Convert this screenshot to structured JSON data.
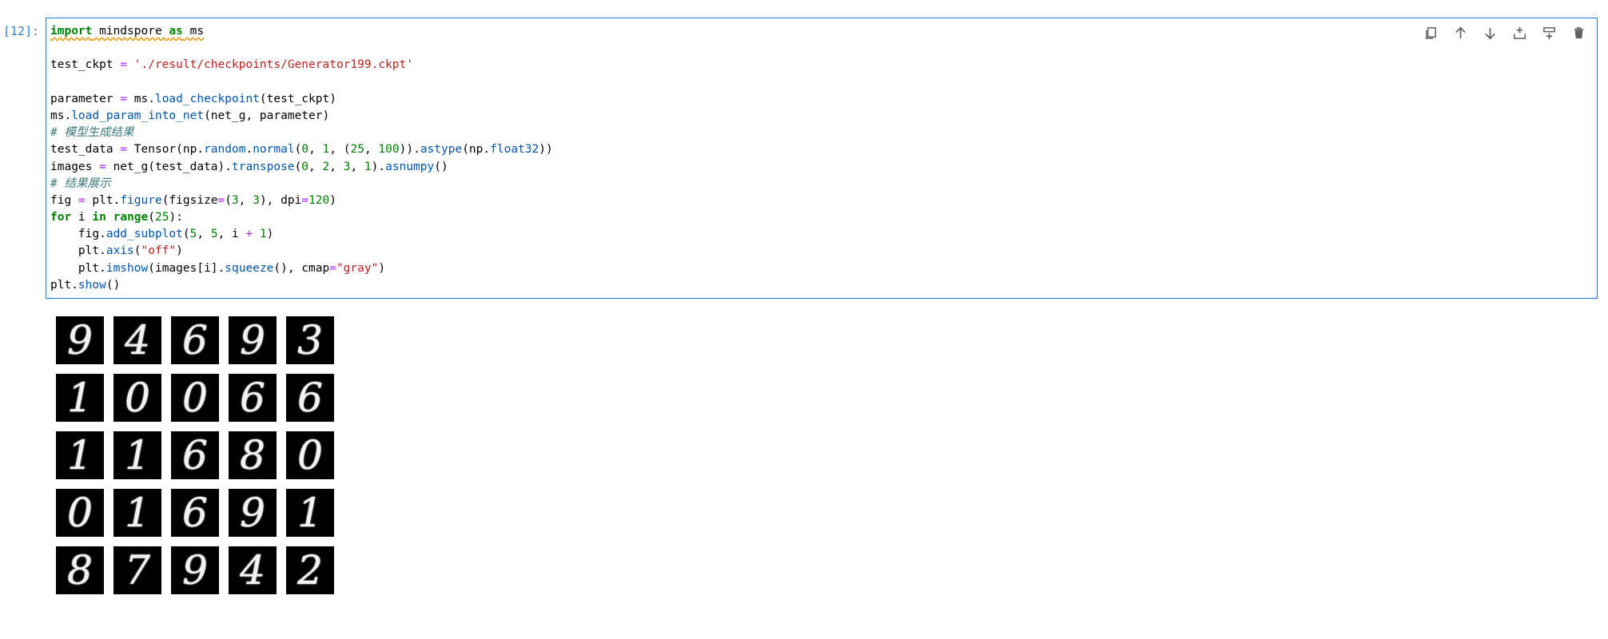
{
  "cell": {
    "prompt": "[12]:",
    "code": {
      "line1": {
        "kw1": "import",
        "mod": " mindspore ",
        "kw2": "as",
        "alias": " ms"
      },
      "line3": {
        "lhs": "test_ckpt ",
        "eq": "=",
        "str": "'./result/checkpoints/Generator199.ckpt'"
      },
      "line5": {
        "a": "parameter ",
        "eq": "=",
        "b": " ms.",
        "fn": "load_checkpoint",
        "c": "(test_ckpt)"
      },
      "line6": {
        "a": "ms.",
        "fn": "load_param_into_net",
        "b": "(net_g, parameter)"
      },
      "line7": {
        "cm": "# 模型生成结果"
      },
      "line8": {
        "a": "test_data ",
        "eq": "=",
        "b": " Tensor(np.",
        "fn1": "random",
        "c": ".",
        "fn2": "normal",
        "d": "(",
        "n1": "0",
        "e": ", ",
        "n2": "1",
        "f": ", (",
        "n3": "25",
        "g": ", ",
        "n4": "100",
        "h": ")).",
        "fn3": "astype",
        "i": "(np.",
        "fn4": "float32",
        "j": "))"
      },
      "line9": {
        "a": "images ",
        "eq": "=",
        "b": " net_g(test_data).",
        "fn1": "transpose",
        "c": "(",
        "n1": "0",
        "d": ", ",
        "n2": "2",
        "e": ", ",
        "n3": "3",
        "f": ", ",
        "n4": "1",
        "g": ").",
        "fn2": "asnumpy",
        "h": "()"
      },
      "line10": {
        "cm": "# 结果展示"
      },
      "line11": {
        "a": "fig ",
        "eq": "=",
        "b": " plt.",
        "fn": "figure",
        "c": "(figsize",
        "eq2": "=",
        "d": "(",
        "n1": "3",
        "e": ", ",
        "n2": "3",
        "f": "), dpi",
        "eq3": "=",
        "n3": "120",
        "g": ")"
      },
      "line12": {
        "kw1": "for",
        "a": " i ",
        "kw2": "in",
        "b": " ",
        "fn": "range",
        "c": "(",
        "n": "25",
        "d": "):"
      },
      "line13": {
        "a": "    fig.",
        "fn": "add_subplot",
        "b": "(",
        "n1": "5",
        "c": ", ",
        "n2": "5",
        "d": ", i ",
        "op": "+",
        "e": " ",
        "n3": "1",
        "f": ")"
      },
      "line14": {
        "a": "    plt.",
        "fn": "axis",
        "b": "(",
        "str": "\"off\"",
        "c": ")"
      },
      "line15": {
        "a": "    plt.",
        "fn1": "imshow",
        "b": "(images[i].",
        "fn2": "squeeze",
        "c": "(), cmap",
        "eq": "=",
        "str": "\"gray\"",
        "d": ")"
      },
      "line16": {
        "a": "plt.",
        "fn": "show",
        "b": "()"
      }
    }
  },
  "toolbar": {
    "icons": [
      "copy-icon",
      "arrow-up-icon",
      "arrow-down-icon",
      "insert-below-icon",
      "insert-above-icon",
      "trash-icon"
    ]
  },
  "output": {
    "digits": [
      "9",
      "4",
      "6",
      "9",
      "3",
      "1",
      "0",
      "0",
      "6",
      "6",
      "1",
      "1",
      "6",
      "8",
      "0",
      "0",
      "1",
      "6",
      "9",
      "1",
      "8",
      "7",
      "9",
      "4",
      "2"
    ]
  },
  "colors": {
    "active_border": "#1976d2",
    "prompt": "#307fc1",
    "keyword": "#008000",
    "function": "#0055aa",
    "string": "#ba2121",
    "comment": "#3d7b7b",
    "operator": "#aa22ff"
  }
}
